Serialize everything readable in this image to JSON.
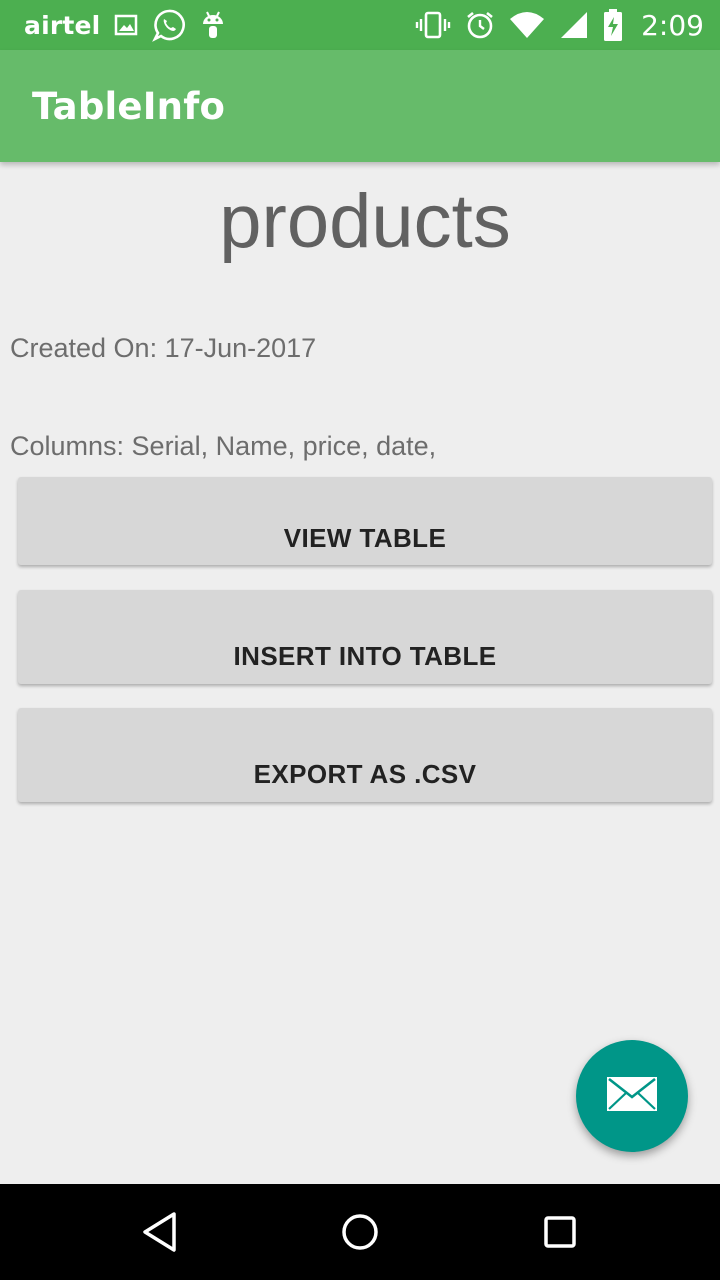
{
  "status_bar": {
    "carrier": "airtel",
    "time": "2:09",
    "icons_left": [
      "image-icon",
      "whatsapp-icon",
      "android-icon"
    ],
    "icons_right": [
      "vibrate-icon",
      "alarm-icon",
      "wifi-icon",
      "signal-icon",
      "battery-charging-icon"
    ],
    "color": "#4caf50"
  },
  "app_bar": {
    "title": "TableInfo",
    "color": "#66bb6a"
  },
  "content": {
    "table_name": "products",
    "created_on": "Created On: 17-Jun-2017",
    "columns": "Columns: Serial, Name, price, date,"
  },
  "buttons": {
    "view_table": "VIEW TABLE",
    "insert_into_table": "INSERT INTO TABLE",
    "export_csv": "EXPORT AS .CSV"
  },
  "fab": {
    "icon": "email-icon",
    "color": "#009688"
  },
  "nav_bar": {
    "icons": [
      "back-icon",
      "home-icon",
      "recent-apps-icon"
    ]
  }
}
